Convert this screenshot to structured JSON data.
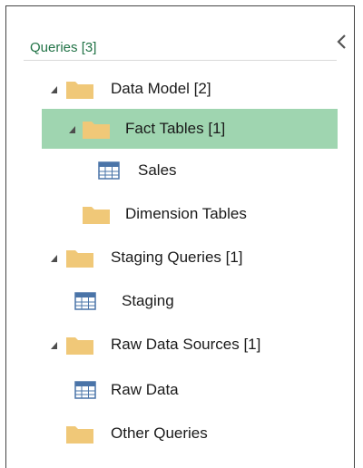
{
  "pane": {
    "title": "Queries [3]",
    "collapse_icon": "chevron-left-icon"
  },
  "tree": {
    "data_model": {
      "label": "Data Model [2]",
      "expanded": true
    },
    "fact_tables": {
      "label": "Fact Tables [1]",
      "expanded": true,
      "selected": true
    },
    "sales": {
      "label": "Sales"
    },
    "dimension_tables": {
      "label": "Dimension Tables"
    },
    "staging_queries": {
      "label": "Staging Queries [1]",
      "expanded": true
    },
    "staging": {
      "label": "Staging"
    },
    "raw_data_sources": {
      "label": "Raw Data Sources [1]",
      "expanded": true
    },
    "raw_data": {
      "label": "Raw Data"
    },
    "other_queries": {
      "label": "Other Queries"
    }
  },
  "colors": {
    "accent_green": "#217346",
    "selection": "#9fd5b0",
    "folder": "#f0c878",
    "table_icon": "#4a74a8"
  }
}
